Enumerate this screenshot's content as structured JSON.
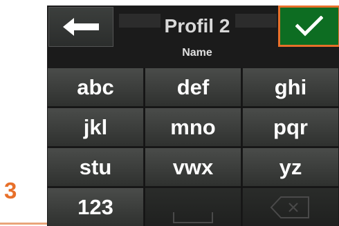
{
  "step": {
    "number": "3"
  },
  "header": {
    "title": "Profil 2",
    "subtitle": "Name",
    "back_icon": "arrow-left-icon",
    "confirm_icon": "checkmark-icon"
  },
  "keypad": {
    "rows": [
      [
        "abc",
        "def",
        "ghi"
      ],
      [
        "jkl",
        "mno",
        "pqr"
      ],
      [
        "stu",
        "vwx",
        "yz"
      ]
    ],
    "bottom_left": "123",
    "space_icon": "space-icon",
    "backspace_icon": "backspace-icon"
  },
  "colors": {
    "accent_orange": "#e8702a",
    "confirm_green": "#0d6d22",
    "key_top": "#4a4c4a",
    "key_bottom": "#2f312f"
  }
}
